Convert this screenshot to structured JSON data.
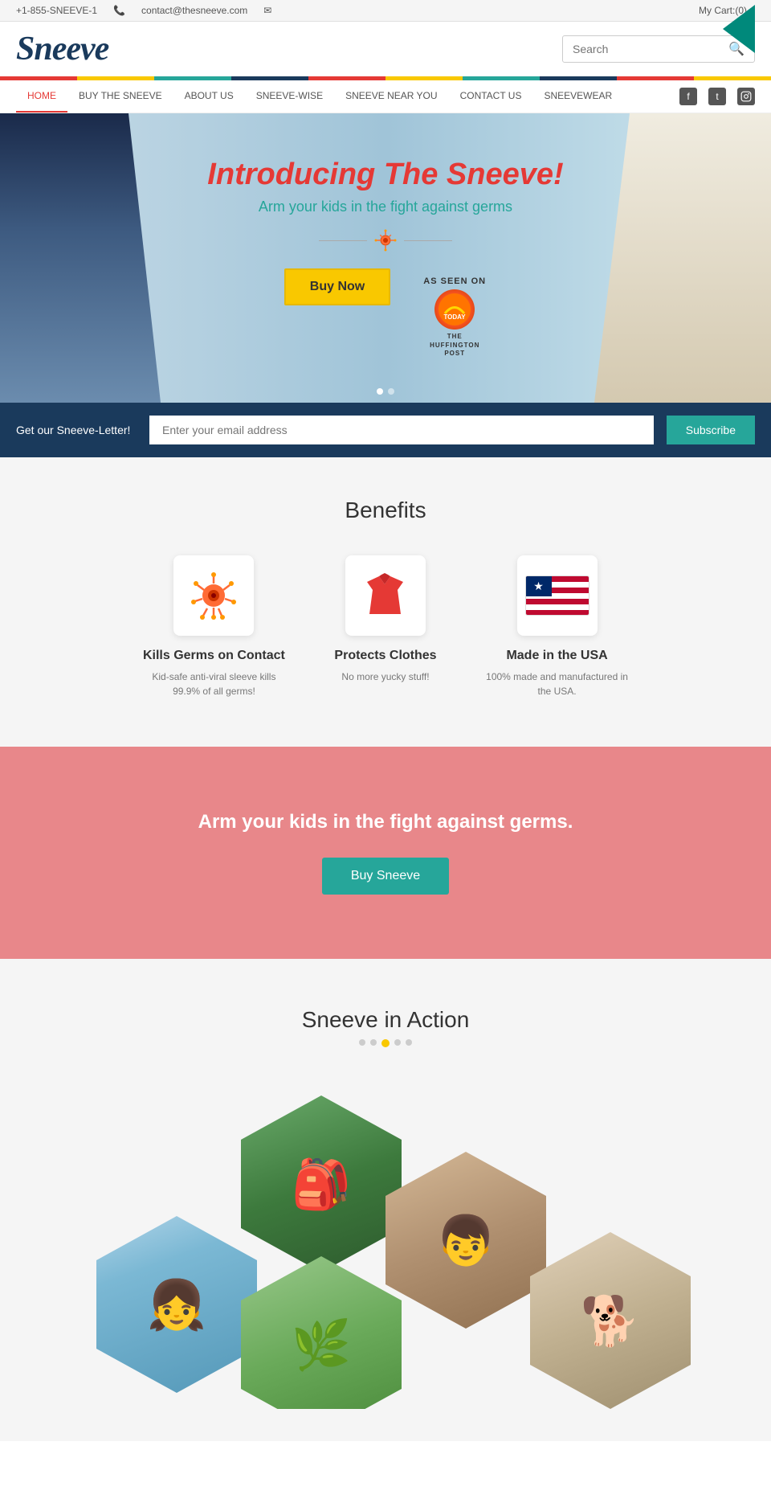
{
  "topbar": {
    "phone": "+1-855-SNEEVE-1",
    "email": "contact@thesneeve.com",
    "cart": "My Cart:(0)"
  },
  "header": {
    "logo": "Sneeve",
    "search_placeholder": "Search"
  },
  "nav": {
    "links": [
      {
        "label": "HOME",
        "active": true
      },
      {
        "label": "BUY THE SNEEVE",
        "active": false
      },
      {
        "label": "ABOUT US",
        "active": false
      },
      {
        "label": "SNEEVE-WISE",
        "active": false
      },
      {
        "label": "SNEEVE NEAR YOU",
        "active": false
      },
      {
        "label": "CONTACT US",
        "active": false
      },
      {
        "label": "SNEEVEWEAR",
        "active": false
      }
    ]
  },
  "hero": {
    "title": "Introducing The Sneeve!",
    "subtitle": "Arm your kids in the fight against germs",
    "buy_btn": "Buy Now",
    "as_seen_on": "AS SEEN ON",
    "today": "TODAY",
    "huffington": "THE HUFFINGTON POST"
  },
  "newsletter": {
    "label": "Get our Sneeve-Letter!",
    "placeholder": "Enter your email address",
    "button": "Subscribe"
  },
  "benefits": {
    "title": "Benefits",
    "items": [
      {
        "icon": "🦠",
        "title": "Kills Germs on Contact",
        "desc": "Kid-safe anti-viral sleeve kills 99.9% of all germs!"
      },
      {
        "icon": "👕",
        "title": "Protects Clothes",
        "desc": "No more yucky stuff!"
      },
      {
        "icon": "🇺🇸",
        "title": "Made in the USA",
        "desc": "100% made and manufactured in the USA."
      }
    ]
  },
  "cta": {
    "title": "Arm your kids in the fight against germs.",
    "button": "Buy Sneeve"
  },
  "action": {
    "title": "Sneeve in Action",
    "dots": [
      {
        "active": false
      },
      {
        "active": false
      },
      {
        "active": true
      },
      {
        "active": false
      },
      {
        "active": false
      }
    ]
  },
  "social": {
    "facebook": "f",
    "twitter": "t",
    "instagram": "ig"
  }
}
